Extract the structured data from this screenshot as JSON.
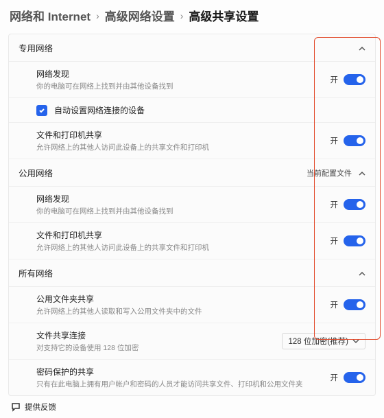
{
  "breadcrumb": {
    "crumb1": "网络和 Internet",
    "crumb2": "高级网络设置",
    "current": "高级共享设置",
    "sep": "›"
  },
  "sections": {
    "private": {
      "header": "专用网络",
      "networkDiscovery": {
        "title": "网络发现",
        "sub": "你的电脑可在网络上找到并由其他设备找到",
        "state": "开"
      },
      "autoSetup": {
        "label": "自动设置网络连接的设备"
      },
      "filePrinter": {
        "title": "文件和打印机共享",
        "sub": "允许网络上的其他人访问此设备上的共享文件和打印机",
        "state": "开"
      }
    },
    "public": {
      "header": "公用网络",
      "badge": "当前配置文件",
      "networkDiscovery": {
        "title": "网络发现",
        "sub": "你的电脑可在网络上找到并由其他设备找到",
        "state": "开"
      },
      "filePrinter": {
        "title": "文件和打印机共享",
        "sub": "允许网络上的其他人访问此设备上的共享文件和打印机",
        "state": "开"
      }
    },
    "all": {
      "header": "所有网络",
      "publicFolder": {
        "title": "公用文件夹共享",
        "sub": "允许网络上的其他人读取和写入公用文件夹中的文件",
        "state": "开"
      },
      "fileConn": {
        "title": "文件共享连接",
        "sub": "对支持它的设备使用 128 位加密",
        "select": "128 位加密(推荐)"
      },
      "pwdProtect": {
        "title": "密码保护的共享",
        "sub": "只有在此电脑上拥有用户帐户和密码的人员才能访问共享文件、打印机和公用文件夹",
        "state": "开"
      }
    }
  },
  "feedback": "提供反馈"
}
